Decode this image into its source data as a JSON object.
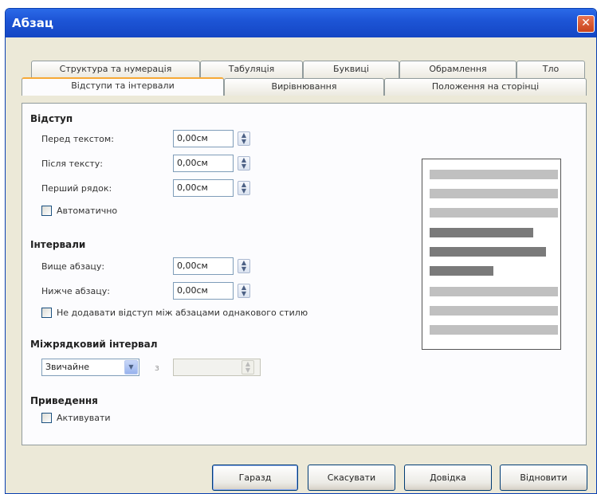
{
  "window": {
    "title": "Абзац",
    "close": "✕"
  },
  "tabs_row1": [
    {
      "label": "Структура та нумерація"
    },
    {
      "label": "Табуляція"
    },
    {
      "label": "Буквиці"
    },
    {
      "label": "Обрамлення"
    },
    {
      "label": "Тло"
    }
  ],
  "tabs_row2": [
    {
      "label": "Відступи та інтервали"
    },
    {
      "label": "Вирівнювання"
    },
    {
      "label": "Положення на сторінці"
    }
  ],
  "indent": {
    "heading": "Відступ",
    "before_label": "Перед текстом:",
    "before_value": "0,00см",
    "after_label": "Після тексту:",
    "after_value": "0,00см",
    "first_label": "Перший рядок:",
    "first_value": "0,00см",
    "auto_label": "Автоматично"
  },
  "spacing": {
    "heading": "Інтервали",
    "above_label": "Вище абзацу:",
    "above_value": "0,00см",
    "below_label": "Нижче абзацу:",
    "below_value": "0,00см",
    "no_space_label": "Не додавати відступ між абзацами однакового стилю"
  },
  "line_spacing": {
    "heading": "Міжрядковий інтервал",
    "selected": "Звичайне",
    "of_label": "з",
    "value": ""
  },
  "register": {
    "heading": "Приведення",
    "activate_label": "Активувати"
  },
  "colors": {
    "line_light": "#c0c0c0",
    "line_dark": "#7a7a7a",
    "tab_highlight": "#f7a936"
  },
  "buttons": {
    "ok": "Гаразд",
    "cancel": "Скасувати",
    "help": "Довідка",
    "reset": "Відновити"
  }
}
